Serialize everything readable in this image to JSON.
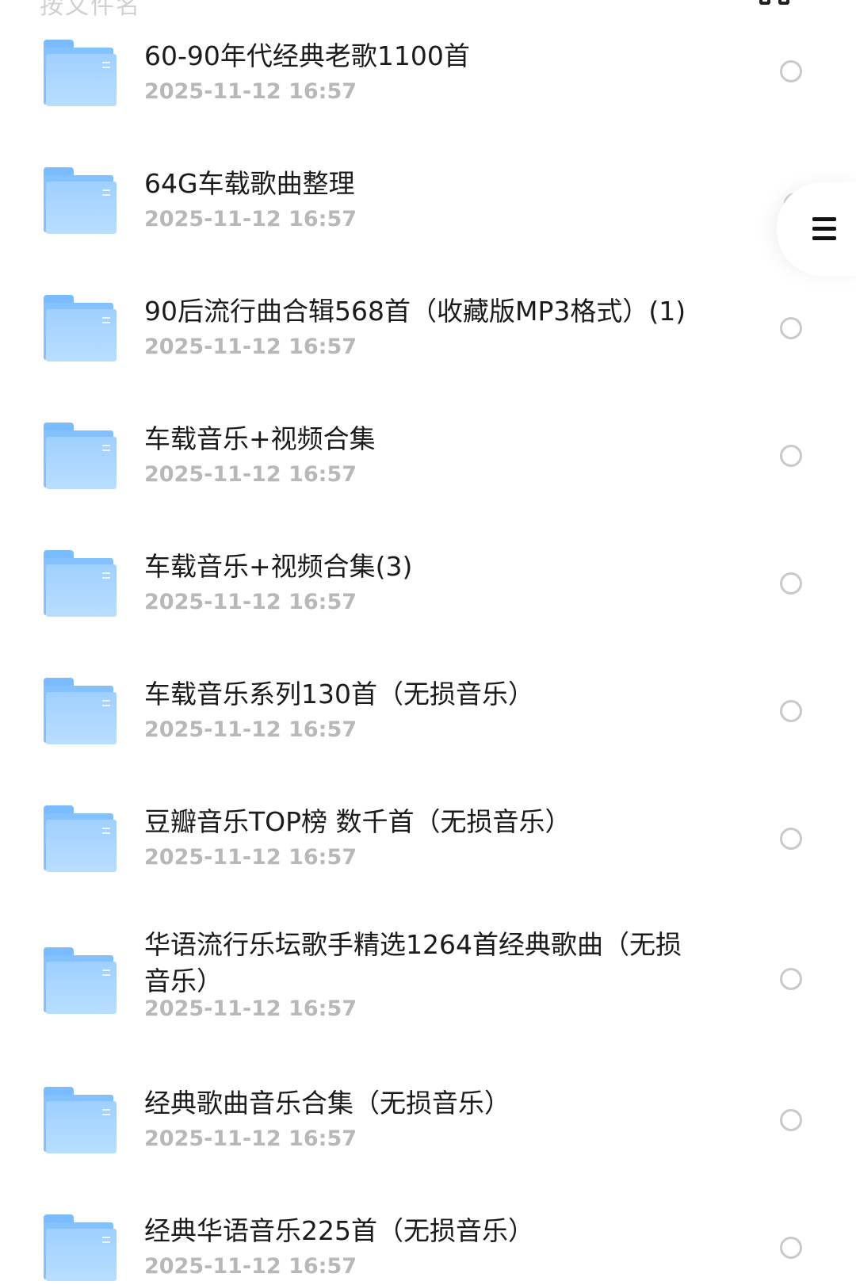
{
  "header": {
    "partial_label": "按文件名",
    "partial_icon": "grid-view-icon"
  },
  "menu": {
    "icon": "menu-icon"
  },
  "files": [
    {
      "name": "60-90年代经典老歌1100首",
      "date": "2025-11-12 16:57",
      "icon": "folder-icon"
    },
    {
      "name": "64G车载歌曲整理",
      "date": "2025-11-12 16:57",
      "icon": "folder-icon"
    },
    {
      "name": "90后流行曲合辑568首（收藏版MP3格式）(1)",
      "date": "2025-11-12 16:57",
      "icon": "folder-icon"
    },
    {
      "name": "车载音乐+视频合集",
      "date": "2025-11-12 16:57",
      "icon": "folder-icon"
    },
    {
      "name": "车载音乐+视频合集(3)",
      "date": "2025-11-12 16:57",
      "icon": "folder-icon"
    },
    {
      "name": "车载音乐系列130首（无损音乐）",
      "date": "2025-11-12 16:57",
      "icon": "folder-icon"
    },
    {
      "name": "豆瓣音乐TOP榜 数千首（无损音乐）",
      "date": "2025-11-12 16:57",
      "icon": "folder-icon"
    },
    {
      "name": "华语流行乐坛歌手精选1264首经典歌曲（无损音乐）",
      "date": "2025-11-12 16:57",
      "icon": "folder-icon"
    },
    {
      "name": "经典歌曲音乐合集（无损音乐）",
      "date": "2025-11-12 16:57",
      "icon": "folder-icon"
    },
    {
      "name": "经典华语音乐225首（无损音乐）",
      "date": "2025-11-12 16:57",
      "icon": "folder-icon"
    }
  ]
}
